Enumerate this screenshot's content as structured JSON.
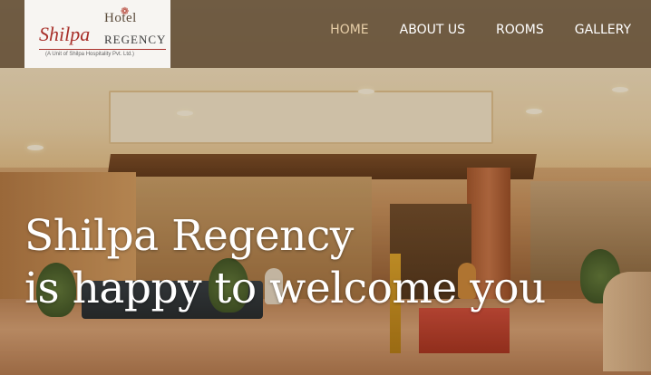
{
  "logo": {
    "hotel": "Hotel",
    "name_script": "Shilpa",
    "name_caps": "REGENCY",
    "tagline": "(A Unit of Shilpa Hospitality Pvt. Ltd.)",
    "icon": "flame-icon"
  },
  "nav": {
    "items": [
      {
        "label": "HOME",
        "active": true
      },
      {
        "label": "ABOUT US",
        "active": false
      },
      {
        "label": "ROOMS",
        "active": false
      },
      {
        "label": "GALLERY",
        "active": false
      }
    ]
  },
  "hero": {
    "line1": "Shilpa Regency",
    "line2": "is happy to welcome you"
  },
  "colors": {
    "header_bg": "#5c4832",
    "nav_active": "#e8cfa8",
    "brand_red": "#a8302a"
  }
}
